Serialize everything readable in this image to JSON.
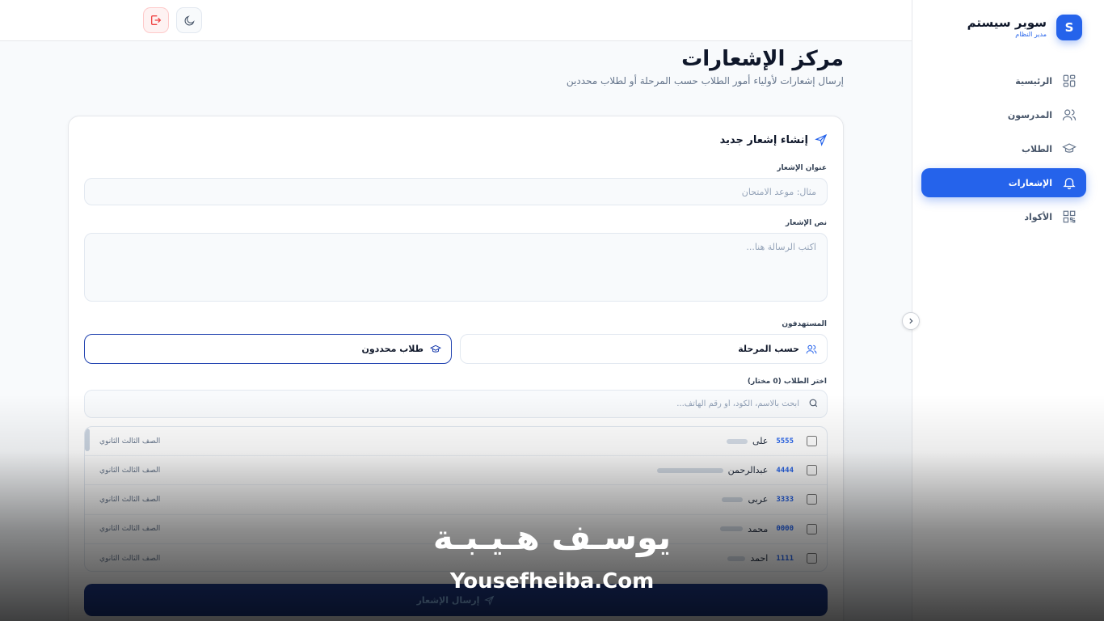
{
  "topbar": {},
  "sidebar": {
    "brand_title": "سوبر سيستم",
    "brand_sub": "مدير النظام",
    "brand_initial": "S",
    "items": [
      {
        "label": "الرئيسية",
        "icon": "grid-icon"
      },
      {
        "label": "المدرسون",
        "icon": "users-icon"
      },
      {
        "label": "الطلاب",
        "icon": "graduation-cap-icon"
      },
      {
        "label": "الإشعارات",
        "icon": "bell-icon",
        "active": true
      },
      {
        "label": "الأكواد",
        "icon": "qr-code-icon"
      }
    ]
  },
  "header": {
    "title": "مركز الإشعارات",
    "subtitle": "إرسال إشعارات لأولياء أمور الطلاب حسب المرحلة أو لطلاب محددين"
  },
  "form": {
    "card_title": "إنشاء إشعار جديد",
    "title_label": "عنوان الإشعار",
    "title_placeholder": "مثال: موعد الامتحان",
    "body_label": "نص الإشعار",
    "body_placeholder": "اكتب الرسالة هنا...",
    "targets_label": "المستهدفون",
    "target_stage": "حسب المرحلة",
    "target_students": "طلاب محددون",
    "select_label": "اختر الطلاب (0 مختار)",
    "search_placeholder": "ابحث بالاسم، الكود، أو رقم الهاتف...",
    "submit_label": "إرسال الإشعار"
  },
  "students": [
    {
      "code": "5555",
      "name": "على",
      "grade": "الصف الثالث الثانوي"
    },
    {
      "code": "4444",
      "name": "عبدالرحمن",
      "grade": "الصف الثالث الثانوي"
    },
    {
      "code": "3333",
      "name": "عربى",
      "grade": "الصف الثالث الثانوي"
    },
    {
      "code": "0000",
      "name": "محمد",
      "grade": "الصف الثالث الثانوي"
    },
    {
      "code": "1111",
      "name": "احمد",
      "grade": "الصف الثالث الثانوي"
    }
  ],
  "watermark": {
    "arabic": "يوسـف هـيـبـة",
    "english": "Yousefheiba.Com"
  },
  "colors": {
    "accent": "#2563eb",
    "danger": "#ef4444"
  }
}
